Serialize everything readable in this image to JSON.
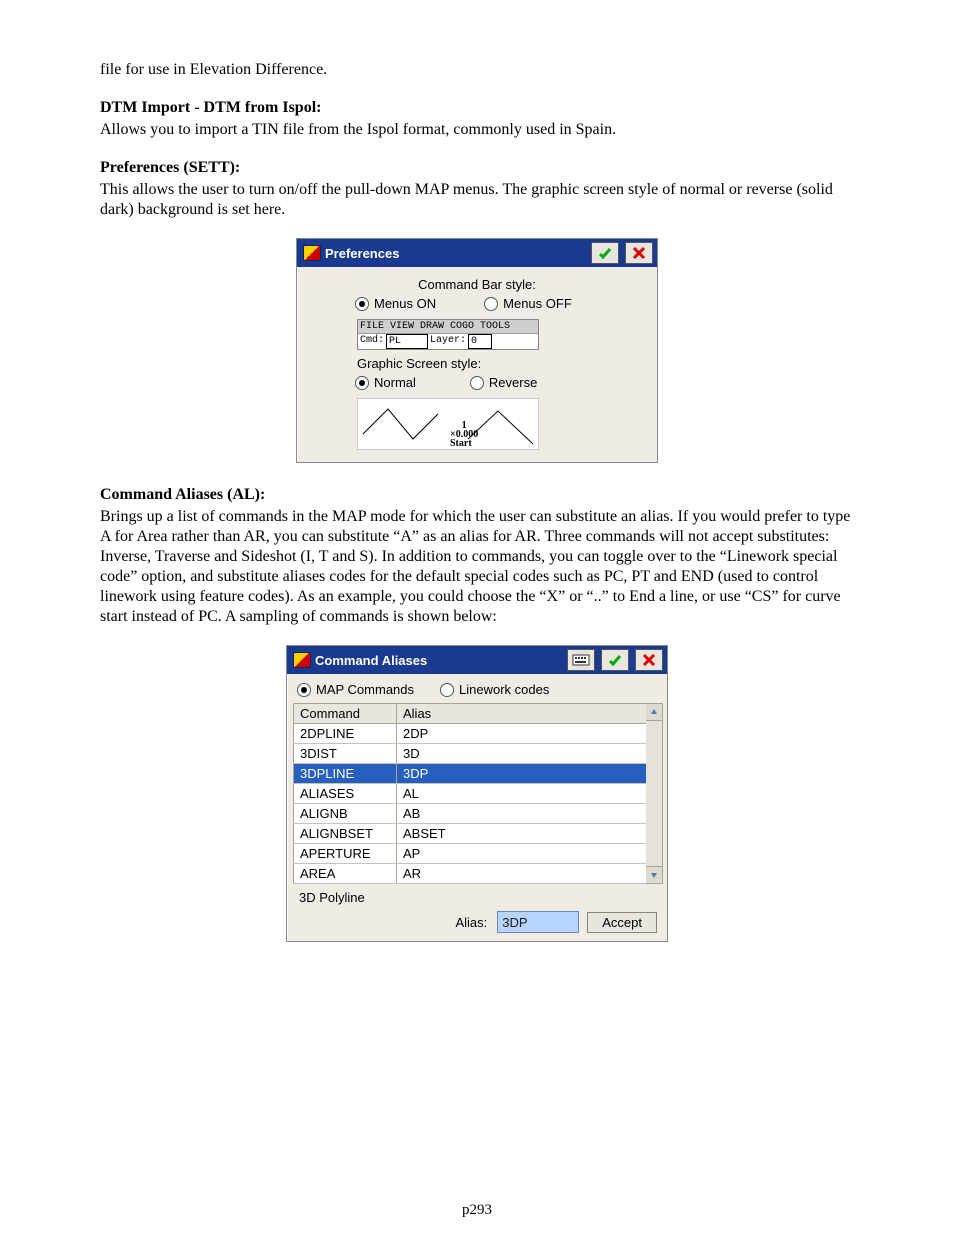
{
  "intro_line": "file for use in Elevation Difference.",
  "dtm": {
    "heading": "DTM Import - DTM from Ispol:",
    "body": "Allows you to import a TIN file from the Ispol format, commonly used in Spain."
  },
  "prefs_text": {
    "heading": "Preferences (SETT):",
    "body": "This allows the user to turn on/off the pull-down MAP menus. The graphic screen style of normal or reverse (solid dark) background is set here."
  },
  "prefs_dialog": {
    "title": "Preferences",
    "cmd_bar_label": "Command Bar style:",
    "menus_on": "Menus ON",
    "menus_off": "Menus OFF",
    "preview_menu": "FILE VIEW DRAW COGO TOOLS",
    "preview_cmd_label": "Cmd:",
    "preview_cmd_value": "PL",
    "preview_layer_label": "Layer:",
    "preview_layer_value": "0",
    "graphic_label": "Graphic Screen style:",
    "normal": "Normal",
    "reverse": "Reverse",
    "gp_line1": "1",
    "gp_line2": "×0.000",
    "gp_line3": "Start"
  },
  "aliases_text": {
    "heading": "Command Aliases (AL):",
    "body": "Brings up a list of commands in the MAP mode for which the user can substitute an alias.  If you would prefer to type A for Area rather than AR, you can substitute “A” as an alias for AR.  Three commands will not accept substitutes: Inverse, Traverse and Sideshot (I, T and S).  In addition to commands, you can toggle over to the “Linework special code” option, and substitute aliases codes for the default special codes such as PC, PT and END (used to control linework using feature codes).  As an example, you could choose the “X” or “..” to End a line, or use “CS” for curve start instead of PC.  A sampling of commands is shown below:"
  },
  "aliases_dialog": {
    "title": "Command Aliases",
    "radio_map": "MAP Commands",
    "radio_linework": "Linework codes",
    "col_command": "Command",
    "col_alias": "Alias",
    "rows": [
      {
        "cmd": "2DPLINE",
        "alias": "2DP",
        "sel": false
      },
      {
        "cmd": "3DIST",
        "alias": "3D",
        "sel": false
      },
      {
        "cmd": "3DPLINE",
        "alias": "3DP",
        "sel": true
      },
      {
        "cmd": "ALIASES",
        "alias": "AL",
        "sel": false
      },
      {
        "cmd": "ALIGNB",
        "alias": "AB",
        "sel": false
      },
      {
        "cmd": "ALIGNBSET",
        "alias": "ABSET",
        "sel": false
      },
      {
        "cmd": "APERTURE",
        "alias": "AP",
        "sel": false
      },
      {
        "cmd": "AREA",
        "alias": "AR",
        "sel": false
      }
    ],
    "status": "3D Polyline",
    "alias_label": "Alias:",
    "alias_value": "3DP",
    "accept": "Accept"
  },
  "page_number": "p293"
}
